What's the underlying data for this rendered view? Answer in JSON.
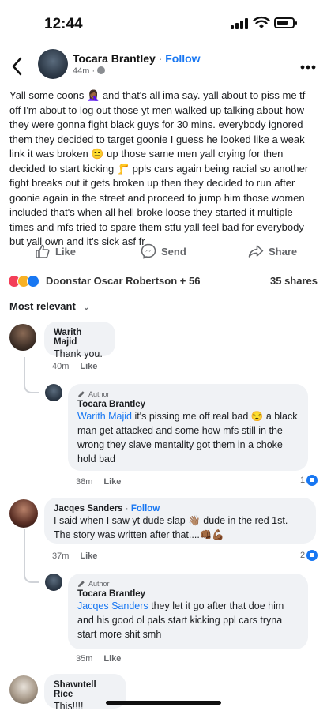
{
  "status": {
    "time": "12:44",
    "battery_level": 0.7
  },
  "post": {
    "author": "Tocara Brantley",
    "separator": "·",
    "follow_label": "Follow",
    "time": "44m",
    "separator_meta": "·",
    "text": "Yall some coons 🤦🏾‍♀️ and that's all ima say. yall about to piss me tf off I'm about to log out those yt men walked up talking about how they were gonna fight black guys for 30 mins. everybody ignored them they decided to target goonie I guess he looked like a weak link it was broken 😑 up those same men yall crying for then decided to start kicking 🦵 ppls cars again being racial so another fight breaks out it gets broken up then they decided to run after goonie again in the street and proceed to jump him those women included that's when all hell broke loose they started it multiple times and mfs tried to spare them stfu yall feel bad for everybody but yall own and it's sick asf fr"
  },
  "actions": {
    "like": "Like",
    "send": "Send",
    "share": "Share"
  },
  "reactions": {
    "names": "Doonstar Oscar Robertson + 56",
    "shares": "35 shares"
  },
  "sort": {
    "label": "Most relevant"
  },
  "comments": [
    {
      "name": "Warith Majid",
      "text": "Thank you.",
      "time": "40m",
      "like_label": "Like"
    },
    {
      "badge": "Author",
      "name": "Tocara Brantley",
      "mention": "Warith Majid",
      "text": " it's pissing me off real bad 😒 a black man get attacked and some how mfs still in the wrong they slave mentality got them in a choke hold bad",
      "time": "38m",
      "like_label": "Like",
      "likes": "1"
    },
    {
      "name": "Jacqes Sanders",
      "separator": "·",
      "follow_label": "Follow",
      "text": "I said when I saw yt dude slap 👋🏽 dude in the red 1st. The story was written after that....👊🏾💪🏾",
      "time": "37m",
      "like_label": "Like",
      "likes": "2"
    },
    {
      "badge": "Author",
      "name": "Tocara Brantley",
      "mention": "Jacqes Sanders",
      "text": " they let it go after that doe him and his good ol pals start kicking ppl cars tryna start more shit smh",
      "time": "35m",
      "like_label": "Like"
    },
    {
      "name": "Shawntell Rice",
      "text": "This!!!!"
    }
  ],
  "colors": {
    "accent": "#1877f2",
    "bubble": "#f0f2f5",
    "muted": "#65676b"
  }
}
